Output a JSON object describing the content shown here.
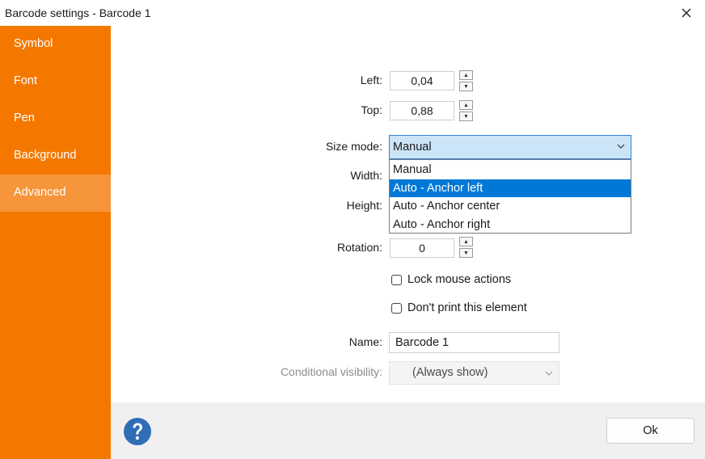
{
  "window": {
    "title": "Barcode settings - Barcode 1"
  },
  "sidebar": {
    "items": [
      {
        "label": "Symbol"
      },
      {
        "label": "Font"
      },
      {
        "label": "Pen"
      },
      {
        "label": "Background"
      },
      {
        "label": "Advanced",
        "active": true
      }
    ]
  },
  "form": {
    "left": {
      "label": "Left:",
      "value": "0,04"
    },
    "top": {
      "label": "Top:",
      "value": "0,88"
    },
    "size_mode": {
      "label": "Size mode:",
      "value": "Manual",
      "options": [
        "Manual",
        "Auto - Anchor left",
        "Auto - Anchor center",
        "Auto - Anchor right"
      ],
      "highlighted_option": "Auto - Anchor left"
    },
    "width": {
      "label": "Width:"
    },
    "height": {
      "label": "Height:"
    },
    "rotation": {
      "label": "Rotation:",
      "value": "0"
    },
    "lock_mouse": {
      "label": "Lock mouse actions",
      "checked": false
    },
    "dont_print": {
      "label": "Don't print this element",
      "checked": false
    },
    "name": {
      "label": "Name:",
      "value": "Barcode 1"
    },
    "conditional_visibility": {
      "label": "Conditional visibility:",
      "value": "(Always show)",
      "enabled": false
    }
  },
  "footer": {
    "ok_label": "Ok",
    "help_icon": "question-circle-icon"
  },
  "colors": {
    "sidebar_bg": "#f47800",
    "sidebar_active": "#f7953a",
    "combo_bg": "#cce4f7",
    "selection": "#0078d7",
    "help_icon": "#2f6db5"
  }
}
